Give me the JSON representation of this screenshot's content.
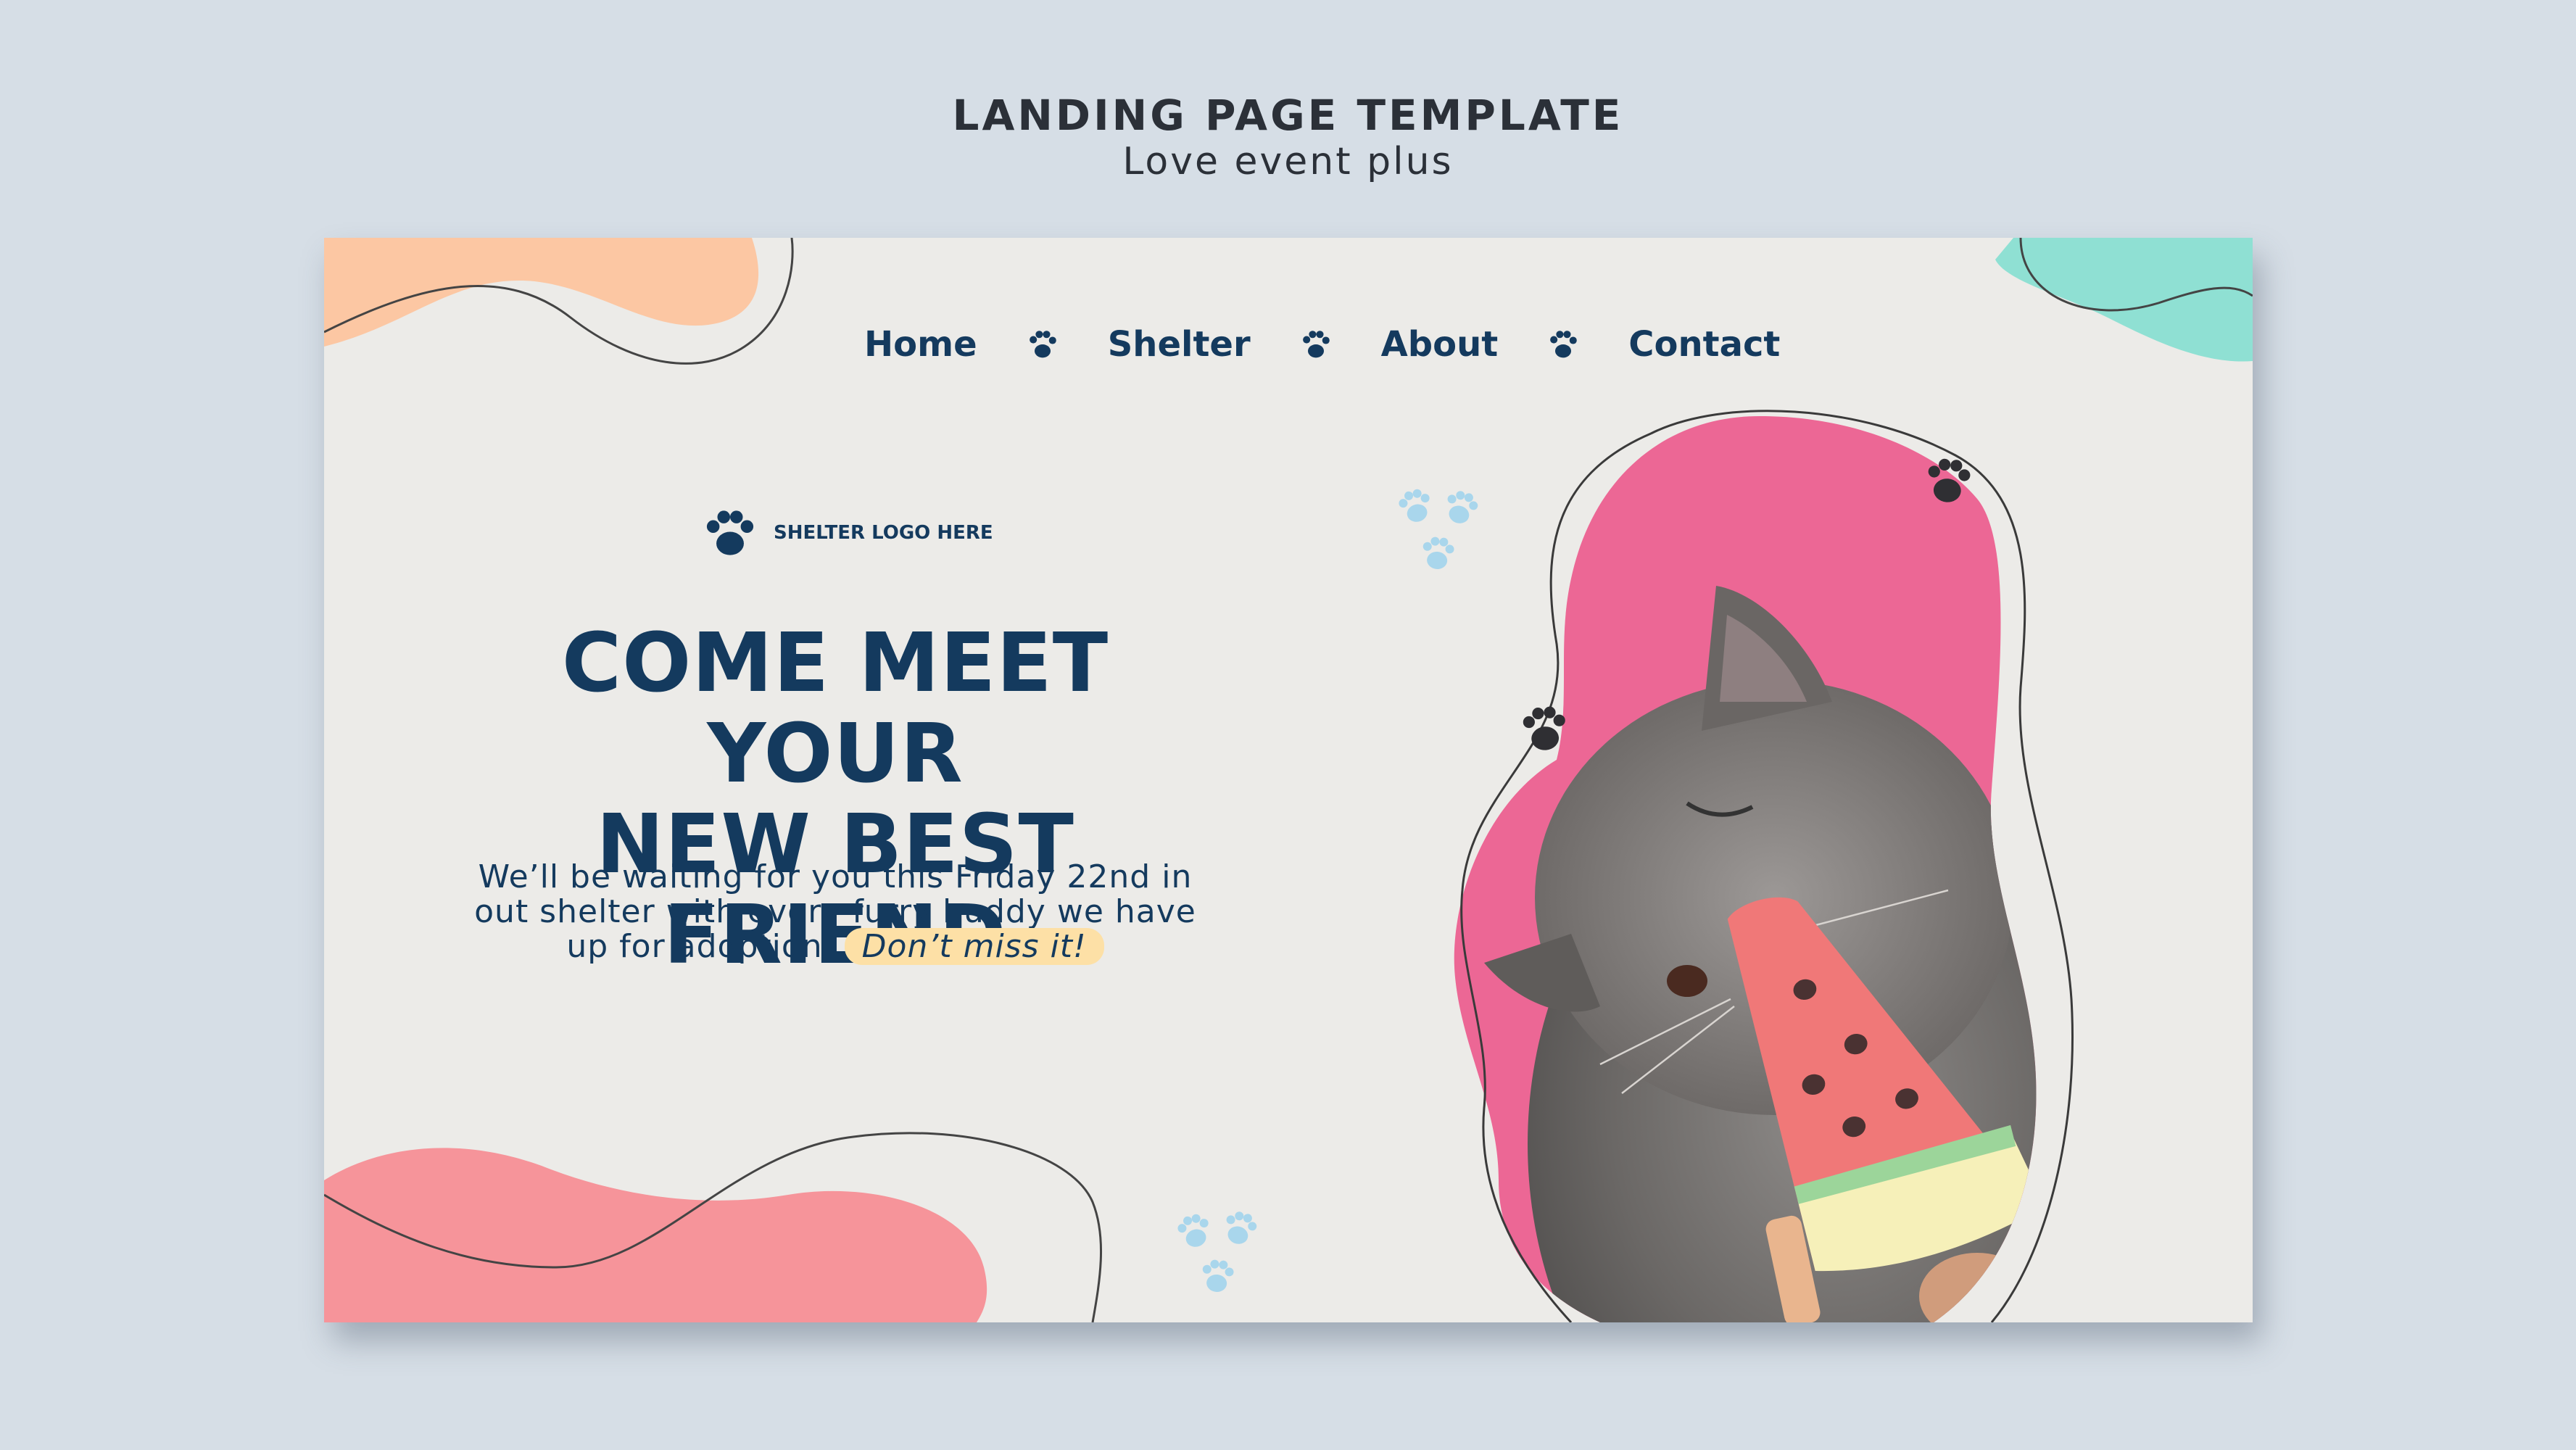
{
  "header": {
    "title": "LANDING PAGE TEMPLATE",
    "subtitle": "Love event plus"
  },
  "nav": {
    "items": [
      "Home",
      "Shelter",
      "About",
      "Contact"
    ],
    "separator_icon": "paw-icon"
  },
  "logo": {
    "text": "SHELTER LOGO HERE",
    "icon": "paw-icon"
  },
  "hero": {
    "headline_line1": "COME MEET YOUR",
    "headline_line2": "NEW BEST FRIEND",
    "body_line1": "We’ll be waiting for you this Friday 22nd in",
    "body_line2": "out shelter with every furry buddy we have",
    "body_line3_prefix": "up for adoption.",
    "body_highlight": "Don’t miss it!"
  },
  "colors": {
    "background": "#d6dee6",
    "card": "#ecebe8",
    "navy": "#143a5e",
    "pink": "#ee6d98",
    "peach": "#fcc7a3",
    "mint": "#8fe0d3",
    "coral": "#f6949a",
    "highlight": "#fde0a6",
    "paw_light_blue": "#a9d6ec"
  },
  "image": {
    "subject": "grey cat licking a watermelon popsicle"
  }
}
